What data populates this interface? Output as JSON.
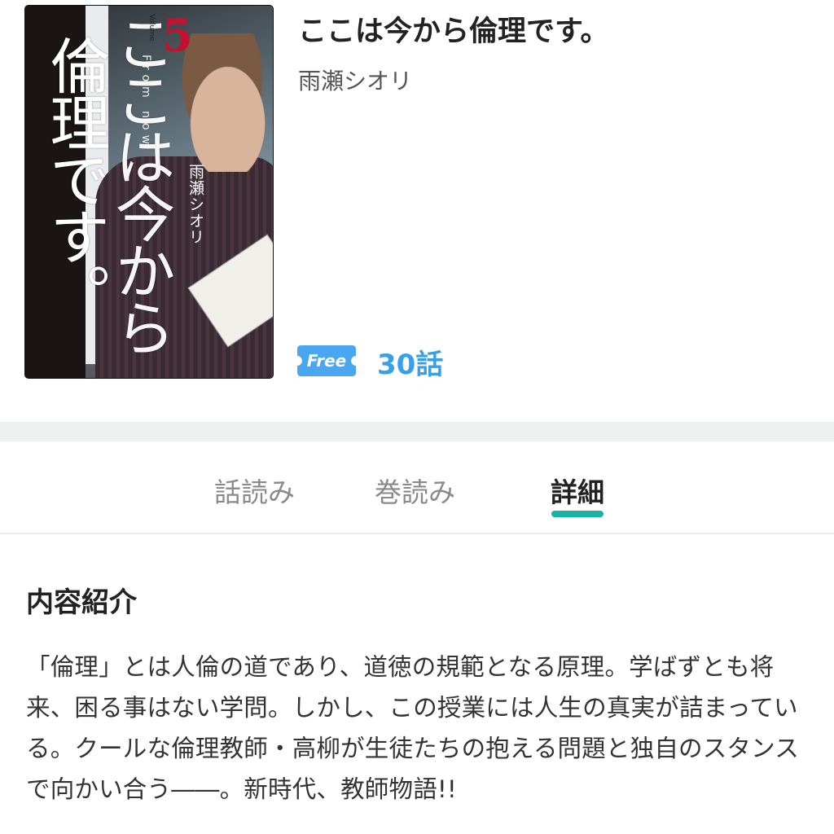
{
  "book": {
    "title": "ここは今から倫理です。",
    "author": "雨瀬シオリ",
    "badge": "Free",
    "episodes": "30話"
  },
  "cover": {
    "title_line_a": "倫理です。",
    "title_line_b": "ここは今から",
    "volume_number": "5",
    "volume_label": "Volume",
    "author_text": "雨瀬シオリ",
    "subtitle_text": "From now"
  },
  "tabs": [
    {
      "label": "話読み",
      "active": false
    },
    {
      "label": "巻読み",
      "active": false
    },
    {
      "label": "詳細",
      "active": true
    }
  ],
  "details": {
    "section_title": "内容紹介",
    "description": "「倫理」とは人倫の道であり、道徳の規範となる原理。学ばずとも将来、困る事はない学問。しかし、この授業には人生の真実が詰まっている。クールな倫理教師・高柳が生徒たちの抱える問題と独自のスタンスで向かい合う――。新時代、教師物語!!"
  },
  "colors": {
    "accent_teal": "#19b3a3",
    "free_badge": "#4aa6ee",
    "episodes_text": "#3a9fe8",
    "volume_red": "#c8102e"
  }
}
